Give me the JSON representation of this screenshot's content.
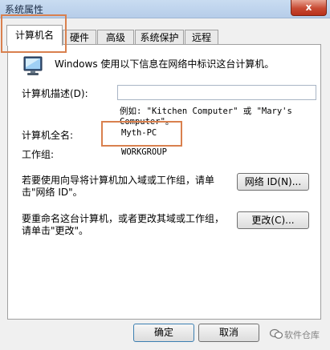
{
  "window": {
    "title": "系统属性",
    "close_label": "x"
  },
  "tabs": [
    {
      "label": "计算机名",
      "active": true
    },
    {
      "label": "硬件",
      "active": false
    },
    {
      "label": "高级",
      "active": false
    },
    {
      "label": "系统保护",
      "active": false
    },
    {
      "label": "远程",
      "active": false
    }
  ],
  "panel": {
    "intro": "Windows 使用以下信息在网络中标识这台计算机。",
    "desc_label": "计算机描述(D):",
    "desc_value": "",
    "example_line1": "例如: \"Kitchen Computer\" 或 \"Mary's",
    "example_line2": "Computer\"。",
    "fullname_label": "计算机全名:",
    "fullname_value": "Myth-PC",
    "workgroup_label": "工作组:",
    "workgroup_value": "WORKGROUP",
    "network_text_line1": "若要使用向导将计算机加入域或工作组，请单",
    "network_text_line2": "击\"网络 ID\"。",
    "network_button": "网络 ID(N)...",
    "rename_text_line1": "要重命名这台计算机，或者更改其域或工作组，",
    "rename_text_line2": "请单击\"更改\"。",
    "change_button": "更改(C)..."
  },
  "footer": {
    "ok_button": "确定",
    "cancel_button": "取消",
    "watermark": "软件仓库"
  }
}
